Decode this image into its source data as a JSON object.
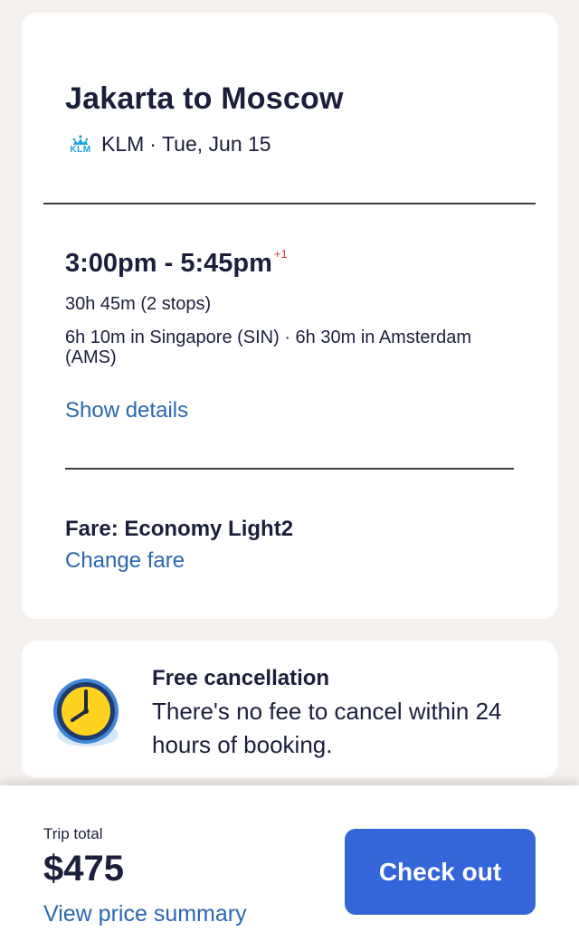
{
  "flight": {
    "title": "Jakarta to Moscow",
    "airline": "KLM",
    "separator": "·",
    "date": "Tue, Jun 15",
    "depart": "3:00pm",
    "dash": "-",
    "arrive": "5:45pm",
    "day_offset": "+1",
    "duration": "30h 45m (2 stops)",
    "layovers": "6h 10m in Singapore (SIN) · 6h 30m in Amsterdam (AMS)",
    "show_details": "Show details",
    "fare": "Fare: Economy Light2",
    "change_fare": "Change fare"
  },
  "cancellation": {
    "icon": "clock-icon",
    "title": "Free cancellation",
    "text": "There's no fee to cancel within 24 hours of booking."
  },
  "footer": {
    "trip_total_label": "Trip total",
    "trip_total": "$475",
    "view_price_summary": "View price summary",
    "checkout_label": "Check out"
  },
  "colors": {
    "background": "#f5f1ef",
    "link": "#2a67b1",
    "button": "#3566d9",
    "klm_blue": "#1aa3e0",
    "day_offset": "#d33a3a"
  },
  "klm_logo": {
    "icon": "klm-logo-icon",
    "text": "KLM"
  }
}
